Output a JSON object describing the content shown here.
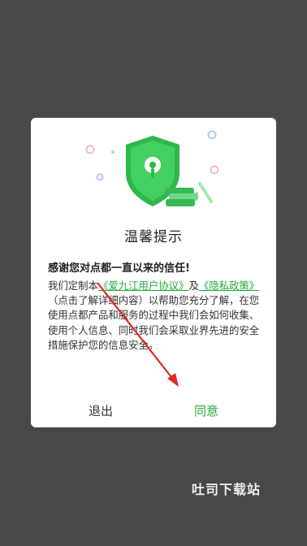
{
  "dialog": {
    "title": "温馨提示",
    "subtitle": "感谢您对点都一直以来的信任!",
    "body": {
      "text1": "我们定制本",
      "link_agreement": "《爱九江用户协议》",
      "text2": "及",
      "link_privacy": "《隐私政策》",
      "text3": "（点击了解详细内容）以帮助您充分了解，在您使用点都产品和服务的过程中我们会如何收集、使用个人信息、同时我们会采取业界先进的安全措施保护您的信息安全。"
    },
    "buttons": {
      "exit": "退出",
      "agree": "同意"
    }
  },
  "watermark": "吐司下载站",
  "colors": {
    "accent": "#22aa3a",
    "overlay": "#484848",
    "arrow": "#e02828"
  },
  "icons": [
    "shield-lock-icon",
    "coin-stack-icon"
  ]
}
